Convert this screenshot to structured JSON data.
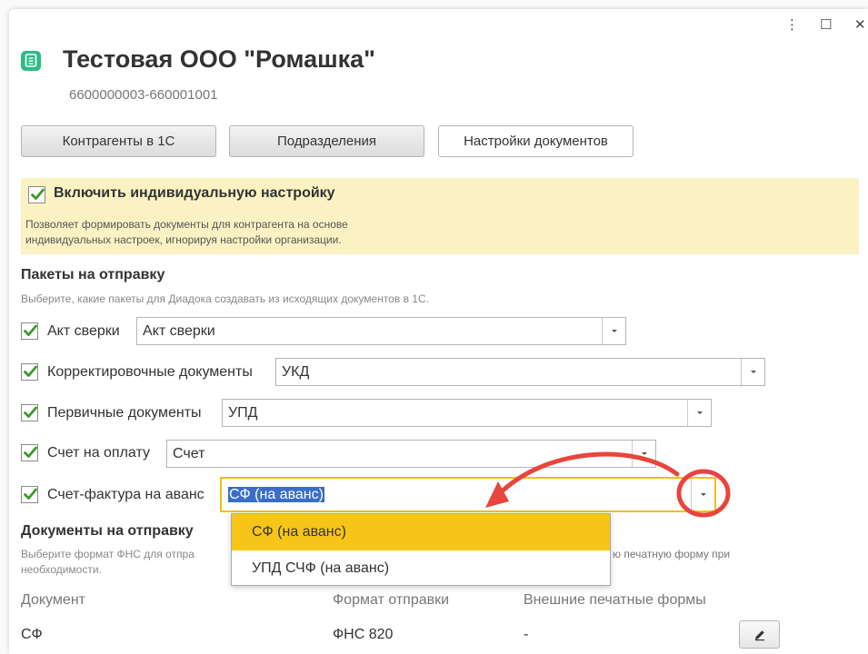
{
  "window": {
    "title": "Тестовая ООО \"Ромашка\"",
    "subtitle": "6600000003-660001001",
    "controls": {
      "more": "⋮",
      "maximize": "☐",
      "close": "✕"
    }
  },
  "toolbar": {
    "counterparties_label": "Контрагенты в 1С",
    "divisions_label": "Подразделения",
    "doc_settings_label": "Настройки документов"
  },
  "individual": {
    "checkbox_label": "Включить индивидуальную настройку",
    "checked": true,
    "description_line1": "Позволяет формировать документы для контрагента на основе",
    "description_line2": "индивидуальных настроек, игнорируя настройки организации."
  },
  "packages": {
    "title": "Пакеты на отправку",
    "hint": "Выберите, какие пакеты для Диадока создавать из исходящих документов в 1С.",
    "rows": [
      {
        "label": "Акт сверки",
        "value": "Акт сверки",
        "checked": true
      },
      {
        "label": "Корректировочные документы",
        "value": "УКД",
        "checked": true
      },
      {
        "label": "Первичные документы",
        "value": "УПД",
        "checked": true
      },
      {
        "label": "Счет на оплату",
        "value": "Счет",
        "checked": true
      },
      {
        "label": "Счет-фактура на аванс",
        "value": "СФ (на аванс)",
        "checked": true
      }
    ]
  },
  "dropdown": {
    "options": [
      "СФ (на аванс)",
      "УПД СЧФ (на аванс)"
    ],
    "selected": "СФ (на аванс)"
  },
  "documents": {
    "title": "Документы на отправку",
    "hint_left_line1": "Выберите формат ФНС для отпра",
    "hint_right_line1": "ю печатную форму при",
    "hint_line2": "необходимости.",
    "columns": [
      "Документ",
      "Формат отправки",
      "Внешние печатные формы"
    ],
    "rows": [
      {
        "document": "СФ",
        "format": "ФНС 820",
        "external": "-"
      }
    ]
  },
  "colors": {
    "accent_green": "#2dbb86",
    "highlight_yellow": "#f7c518",
    "panel_yellow": "#fbf2c4",
    "annotation_red": "#e8453c",
    "check_green": "#3a9a2a"
  },
  "icons": {
    "app": "document-icon",
    "checkbox": "checkmark-icon",
    "dropdown": "chevron-down-icon",
    "edit": "pencil-icon"
  }
}
